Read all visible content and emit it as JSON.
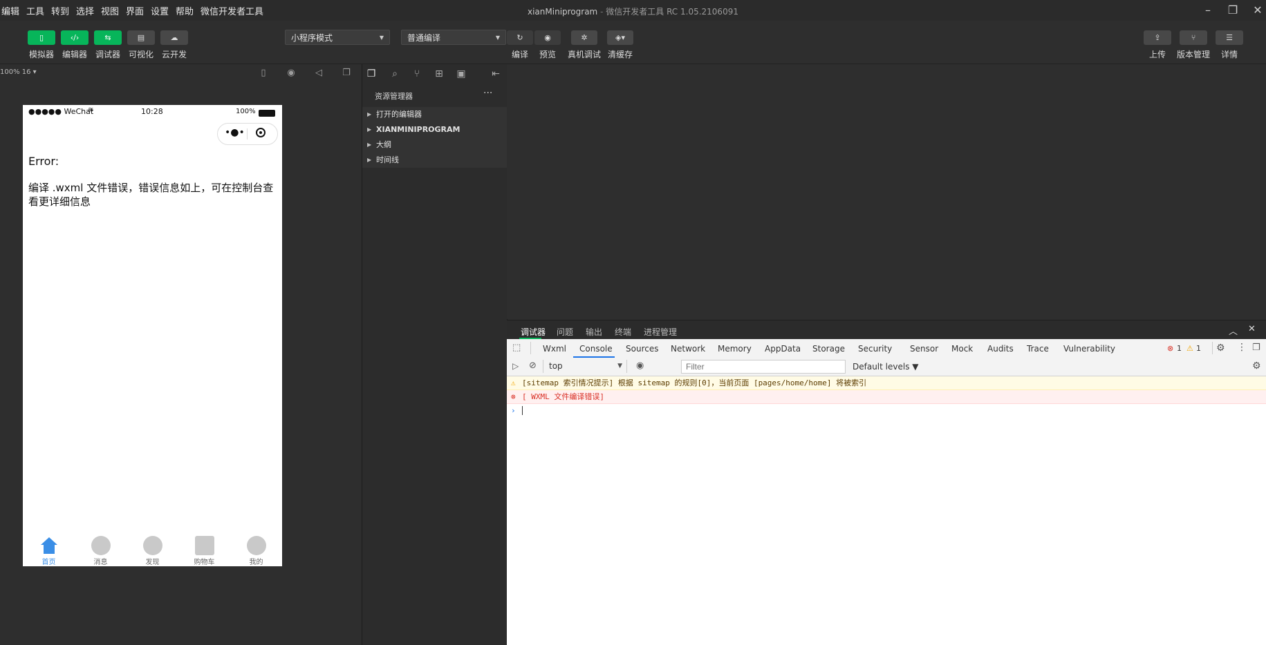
{
  "menu": [
    "编辑",
    "工具",
    "转到",
    "选择",
    "视图",
    "界面",
    "设置",
    "帮助",
    "微信开发者工具"
  ],
  "window": {
    "project": "xianMiniprogram",
    "separator": "-",
    "app": "微信开发者工具 RC 1.05.2106091"
  },
  "toolbar": {
    "left_buttons": [
      {
        "label": "模拟器",
        "icon": "phone-icon"
      },
      {
        "label": "编辑器",
        "icon": "code-icon"
      },
      {
        "label": "调试器",
        "icon": "debug-icon"
      },
      {
        "label": "可视化",
        "icon": "layout-icon"
      },
      {
        "label": "云开发",
        "icon": "cloud-icon"
      }
    ],
    "mode_select": "小程序模式",
    "compile_select": "普通编译",
    "mid_buttons": [
      {
        "label": "编译",
        "icon": "refresh-icon"
      },
      {
        "label": "预览",
        "icon": "eye-icon"
      },
      {
        "label": "真机调试",
        "icon": "bug-icon"
      },
      {
        "label": "清缓存",
        "icon": "layers-icon"
      }
    ],
    "right_buttons": [
      {
        "label": "上传",
        "icon": "upload-icon"
      },
      {
        "label": "版本管理",
        "icon": "branch-icon"
      },
      {
        "label": "详情",
        "icon": "menu-icon"
      }
    ]
  },
  "simulator": {
    "zoom": "100% 16 ▾",
    "status": {
      "carrier": "●●●●● WeChat",
      "time": "10:28",
      "battery": "100%"
    },
    "error_title": "Error:",
    "error_message": "编译 .wxml 文件错误，错误信息如上，可在控制台查看更详细信息",
    "tabs": [
      {
        "label": "首页",
        "active": true
      },
      {
        "label": "消息",
        "active": false
      },
      {
        "label": "发现",
        "active": false
      },
      {
        "label": "购物车",
        "active": false
      },
      {
        "label": "我的",
        "active": false
      }
    ],
    "accent": "#3a8ee6"
  },
  "explorer": {
    "title": "资源管理器",
    "more": "···",
    "items": [
      "打开的编辑器",
      "XIANMINIPROGRAM",
      "大纲",
      "时间线"
    ]
  },
  "debugger": {
    "tabs": [
      "调试器",
      "问题",
      "输出",
      "终端",
      "进程管理"
    ],
    "devtools_tabs": [
      "Wxml",
      "Console",
      "Sources",
      "Network",
      "Memory",
      "AppData",
      "Storage",
      "Security",
      "Sensor",
      "Mock",
      "Audits",
      "Trace",
      "Vulnerability"
    ],
    "active_tab": "Console",
    "error_count": "1",
    "warning_count": "1",
    "context": "top",
    "filter_placeholder": "Filter",
    "levels": "Default levels ▼",
    "messages": [
      {
        "level": "warning",
        "text": "[sitemap 索引情况提示] 根据 sitemap 的规则[0]，当前页面 [pages/home/home] 将被索引"
      },
      {
        "level": "error",
        "text": "[ WXML 文件编译错误]"
      }
    ],
    "prompt": "›"
  }
}
